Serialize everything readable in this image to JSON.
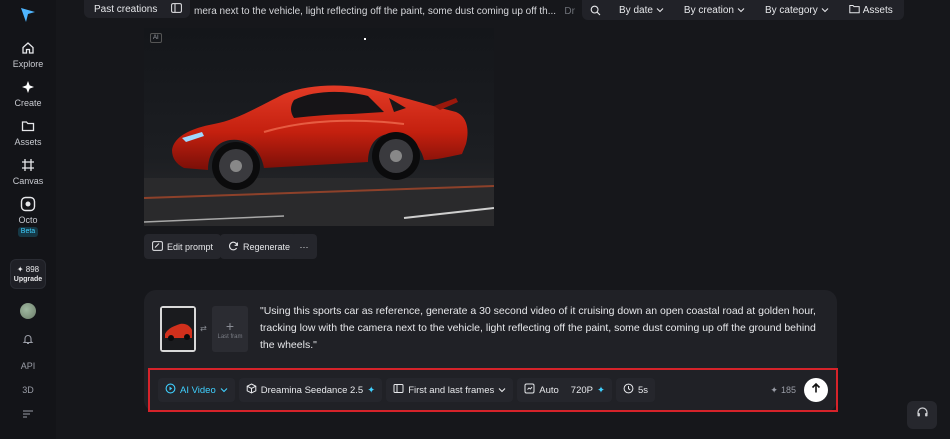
{
  "sidebar": {
    "items": [
      {
        "label": "Explore",
        "icon": "home-icon"
      },
      {
        "label": "Create",
        "icon": "sparkle-icon"
      },
      {
        "label": "Assets",
        "icon": "folder-icon"
      },
      {
        "label": "Canvas",
        "icon": "canvas-icon"
      },
      {
        "label": "Octo",
        "icon": "octo-icon"
      }
    ],
    "beta_badge": "Beta",
    "credits": "898",
    "upgrade_label": "Upgrade",
    "api_label": "API",
    "threed_label": "3D"
  },
  "header": {
    "past_creations_label": "Past creations",
    "prompt_preview": "mera next to the vehicle, light reflecting off the paint, some dust coming up off th...",
    "prompt_preview_faded": "Dr",
    "filters": [
      "By date",
      "By creation",
      "By category"
    ],
    "assets_label": "Assets"
  },
  "image": {
    "ai_badge": "AI"
  },
  "actions": {
    "edit_prompt": "Edit prompt",
    "regenerate": "Regenerate",
    "more": "···"
  },
  "composer": {
    "last_frame_label": "Last fram",
    "prompt": "\"Using this sports car as reference, generate a 30 second video of it cruising down an open coastal road at golden hour, tracking low with the camera next to the vehicle, light reflecting off the paint, some dust coming up off the ground behind the wheels.\"",
    "mode": "AI Video",
    "model": "Dreamina Seedance 2.5",
    "frames": "First and last frames",
    "aspect": "Auto",
    "resolution": "720P",
    "duration": "5s",
    "cost": "185"
  },
  "colors": {
    "accent": "#3fd0ff",
    "highlight_border": "#d6232a",
    "background": "#16171b"
  }
}
